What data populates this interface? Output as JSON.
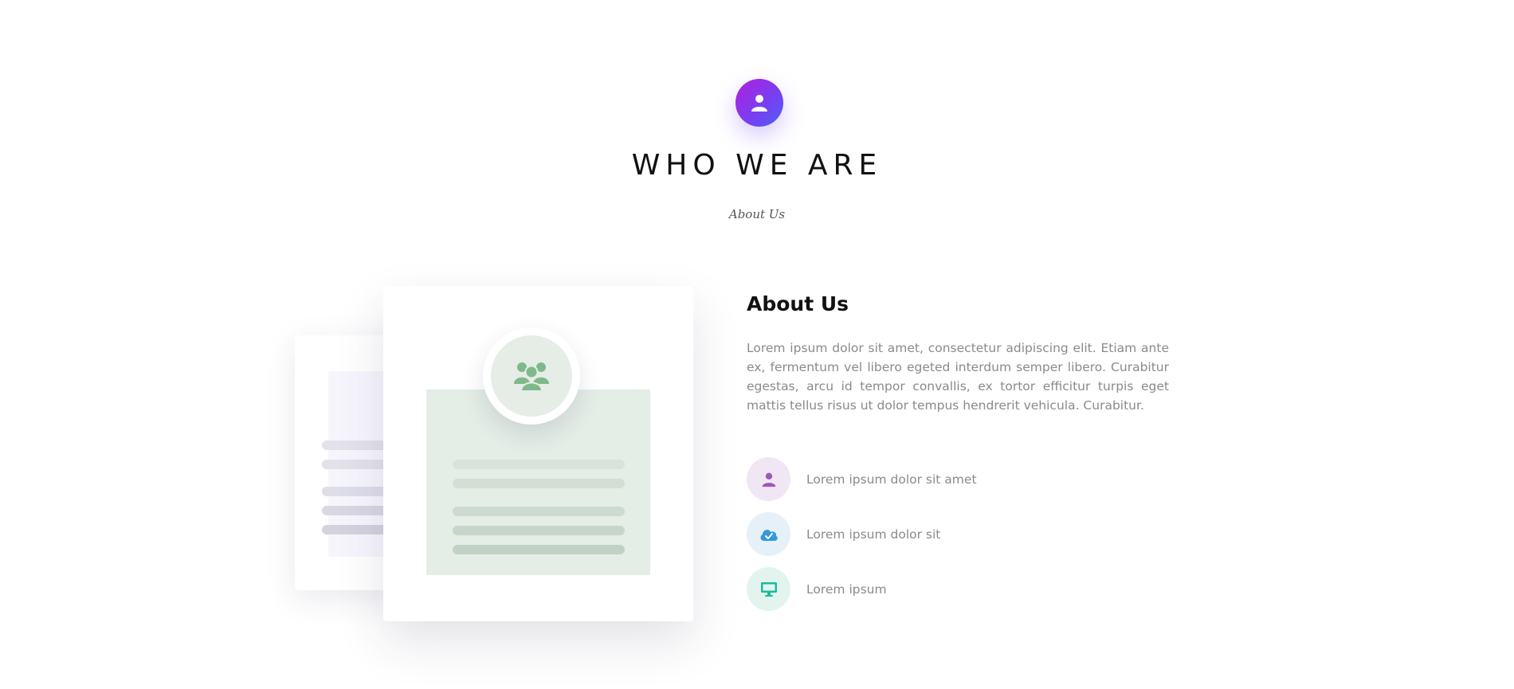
{
  "header": {
    "icon": "user-icon",
    "title": "WHO WE ARE",
    "subtitle": "About Us"
  },
  "illustration": {
    "center_icon": "users-group-icon",
    "colors": {
      "accent_gradient_start": "#b21fe0",
      "accent_gradient_end": "#4f5ff5",
      "panel_green": "#e4ede6",
      "icon_green": "#7fb98a"
    }
  },
  "about": {
    "heading": "About Us",
    "body": "Lorem ipsum dolor sit amet, consectetur adipiscing elit. Etiam ante ex, fermentum vel libero egeted interdum semper libero. Curabitur egestas, arcu id tempor convallis, ex tortor efficitur turpis eget mattis tellus risus ut dolor tempus hendrerit vehicula. Curabitur."
  },
  "features": [
    {
      "icon": "user-icon",
      "label": "Lorem ipsum dolor sit amet",
      "color": "#9b59b6",
      "bg": "#f1e6f3"
    },
    {
      "icon": "cloud-check-icon",
      "label": "Lorem ipsum dolor sit",
      "color": "#3498db",
      "bg": "#e6f0f8"
    },
    {
      "icon": "monitor-icon",
      "label": "Lorem ipsum",
      "color": "#1abc9c",
      "bg": "#e3f4ef"
    }
  ]
}
